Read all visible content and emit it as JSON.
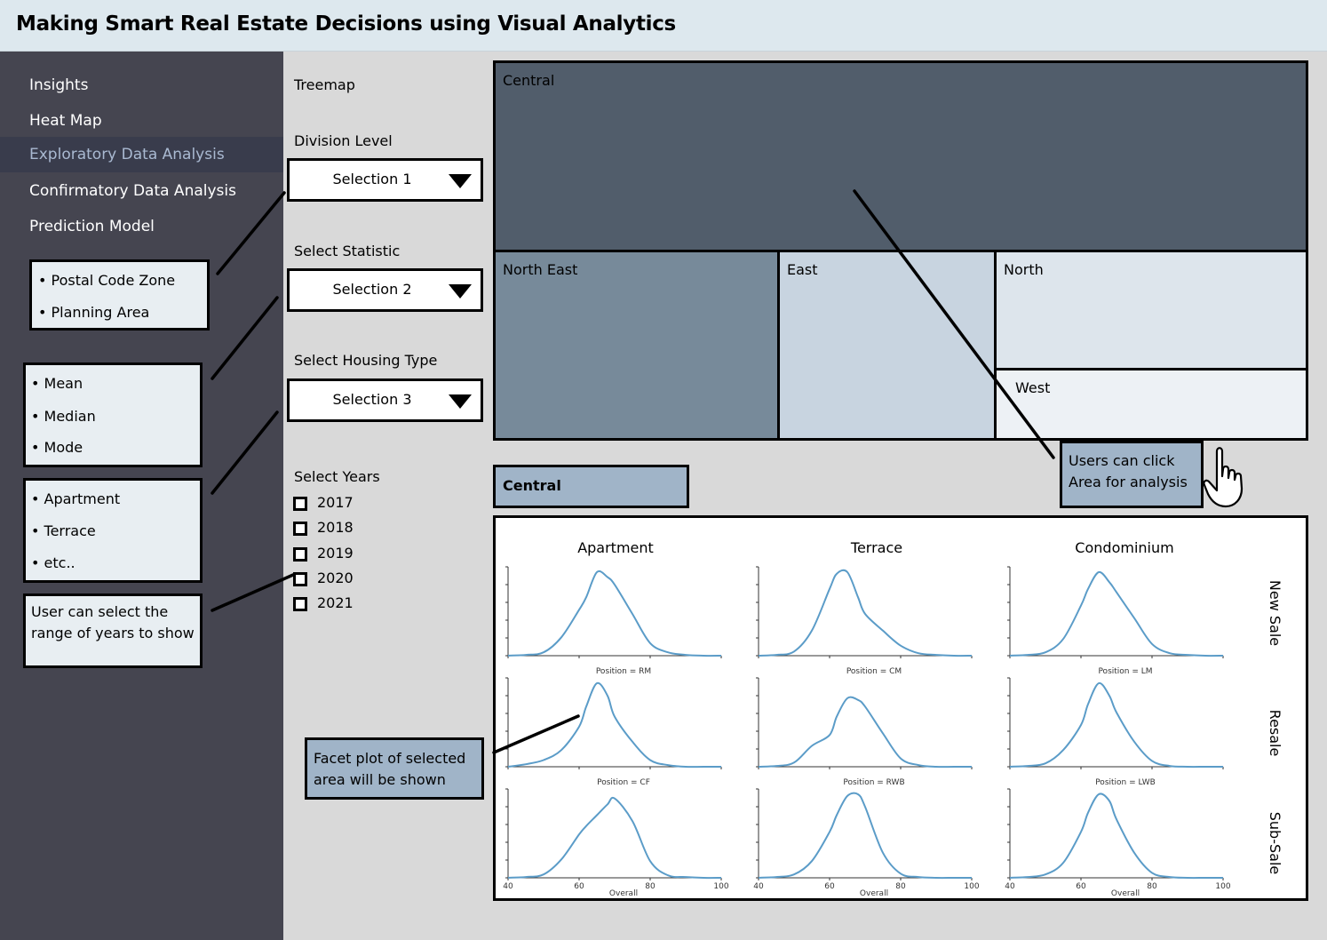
{
  "header": {
    "title": "Making Smart Real Estate Decisions using Visual Analytics"
  },
  "nav": [
    {
      "label": "Insights",
      "active": false
    },
    {
      "label": "Heat Map",
      "active": false
    },
    {
      "label": "Exploratory Data Analysis",
      "active": true
    },
    {
      "label": "Confirmatory Data Analysis",
      "active": false
    },
    {
      "label": "Prediction Model",
      "active": false
    }
  ],
  "notes": {
    "division": [
      "• Postal Code Zone",
      "• Planning Area"
    ],
    "statistic": [
      "• Mean",
      "• Median",
      "• Mode"
    ],
    "housing": [
      "• Apartment",
      "• Terrace",
      "• etc.."
    ],
    "years": "User can select the range of years to show"
  },
  "controls": {
    "panel_title": "Treemap",
    "division_label": "Division Level",
    "division_value": "Selection 1",
    "statistic_label": "Select Statistic",
    "statistic_value": "Selection 2",
    "housing_label": "Select Housing Type",
    "housing_value": "Selection 3",
    "years_label": "Select Years",
    "years": [
      "2017",
      "2018",
      "2019",
      "2020",
      "2021"
    ]
  },
  "treemap": {
    "cells": [
      {
        "label": "Central",
        "color": "#515d6b"
      },
      {
        "label": "North East",
        "color": "#778a9a"
      },
      {
        "label": "East",
        "color": "#c8d4e0"
      },
      {
        "label": "North",
        "color": "#dde5ec"
      },
      {
        "label": "West",
        "color": "#edf1f5"
      }
    ]
  },
  "selected_area": "Central",
  "callouts": {
    "click": "Users can click Area for analysis",
    "facet": "Facet plot of selected area will be shown"
  },
  "facet": {
    "columns": [
      "Apartment",
      "Terrace",
      "Condominium"
    ],
    "rows": [
      "New Sale",
      "Resale",
      "Sub-Sale"
    ],
    "panel_titles": [
      [
        "",
        "",
        ""
      ],
      [
        "Position = RM",
        "Position = CM",
        "Position = LM"
      ],
      [
        "Position = CF",
        "Position = RWB",
        "Position = LWB"
      ]
    ],
    "x_ticks": [
      "40",
      "60",
      "80",
      "100"
    ],
    "x_label": "Overall",
    "line_color": "#5b9cc8"
  },
  "chart_data": {
    "type": "line",
    "title": "",
    "xlabel": "Overall",
    "ylabel": "",
    "xlim": [
      40,
      100
    ],
    "x_ticks": [
      40,
      60,
      80,
      100
    ],
    "x": [
      40,
      45,
      50,
      55,
      60,
      62,
      65,
      68,
      70,
      75,
      80,
      85,
      90,
      95,
      100
    ],
    "grid": false,
    "panels": [
      {
        "row": "New Sale",
        "column": "Apartment",
        "values": [
          0,
          0.01,
          0.04,
          0.22,
          0.55,
          0.7,
          1.0,
          0.94,
          0.85,
          0.5,
          0.15,
          0.04,
          0.01,
          0,
          0
        ]
      },
      {
        "row": "New Sale",
        "column": "Terrace",
        "values": [
          0,
          0.01,
          0.05,
          0.3,
          0.8,
          0.98,
          1.0,
          0.7,
          0.5,
          0.3,
          0.12,
          0.03,
          0.01,
          0,
          0
        ]
      },
      {
        "row": "New Sale",
        "column": "Condominium",
        "values": [
          0,
          0.01,
          0.04,
          0.2,
          0.6,
          0.8,
          1.0,
          0.88,
          0.76,
          0.45,
          0.14,
          0.03,
          0.01,
          0,
          0
        ]
      },
      {
        "row": "Resale",
        "column": "Apartment",
        "values": [
          0,
          0.03,
          0.08,
          0.2,
          0.48,
          0.72,
          1.0,
          0.85,
          0.6,
          0.3,
          0.08,
          0.02,
          0,
          0,
          0
        ]
      },
      {
        "row": "Resale",
        "column": "Terrace",
        "values": [
          0,
          0.01,
          0.05,
          0.25,
          0.38,
          0.6,
          0.82,
          0.8,
          0.72,
          0.4,
          0.1,
          0.02,
          0,
          0,
          0
        ]
      },
      {
        "row": "Resale",
        "column": "Condominium",
        "values": [
          0,
          0.01,
          0.04,
          0.2,
          0.5,
          0.75,
          1.0,
          0.85,
          0.65,
          0.3,
          0.07,
          0.01,
          0,
          0,
          0
        ]
      },
      {
        "row": "Sub-Sale",
        "column": "Apartment",
        "values": [
          0,
          0.01,
          0.04,
          0.22,
          0.52,
          0.62,
          0.75,
          0.88,
          0.95,
          0.68,
          0.2,
          0.03,
          0.01,
          0,
          0
        ]
      },
      {
        "row": "Sub-Sale",
        "column": "Terrace",
        "values": [
          0,
          0.01,
          0.04,
          0.2,
          0.55,
          0.75,
          0.98,
          1.0,
          0.85,
          0.3,
          0.05,
          0.01,
          0,
          0,
          0
        ]
      },
      {
        "row": "Sub-Sale",
        "column": "Condominium",
        "values": [
          0,
          0.01,
          0.04,
          0.18,
          0.55,
          0.78,
          1.0,
          0.92,
          0.7,
          0.3,
          0.06,
          0.01,
          0,
          0,
          0
        ]
      }
    ]
  }
}
